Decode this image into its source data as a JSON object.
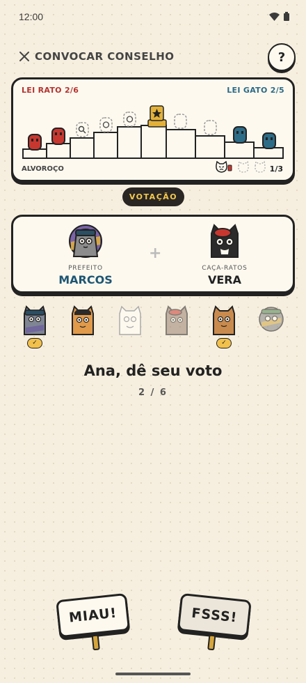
{
  "status_bar": {
    "time": "12:00",
    "icons": [
      "wifi-icon",
      "battery-icon"
    ]
  },
  "header": {
    "close_icon": "close-icon",
    "title": "CONVOCAR CONSELHO",
    "help_label": "?"
  },
  "law_track": {
    "rat_law": "LEI RATO 2/6",
    "cat_law": "LEI GATO 2/5",
    "rat_law_passed": 2,
    "rat_law_total": 6,
    "cat_law_passed": 2,
    "cat_law_total": 5,
    "chaos_label": "ALVOROÇO",
    "chaos_count": "1/3",
    "colors": {
      "rat": "#b3322e",
      "cat": "#2c6a86",
      "gold": "#e3b13a"
    }
  },
  "phase": {
    "label": "VOTAÇÃO"
  },
  "nominees": [
    {
      "role": "PREFEITO",
      "name": "MARCOS",
      "name_color": "#1e5673"
    },
    {
      "role": "CAÇA-RATOS",
      "name": "VERA",
      "name_color": "#222222"
    }
  ],
  "nominee_separator": "+",
  "players": [
    {
      "voted": true,
      "check": "✓",
      "state": "active"
    },
    {
      "voted": false,
      "state": "active"
    },
    {
      "voted": false,
      "state": "ghost"
    },
    {
      "voted": false,
      "state": "faded"
    },
    {
      "voted": true,
      "check": "✓",
      "state": "active"
    },
    {
      "voted": false,
      "state": "faded"
    }
  ],
  "prompt": {
    "text": "Ana, dê seu voto",
    "progress": "2 / 6"
  },
  "vote_buttons": {
    "yes": "MIAU!",
    "no": "FSSS!"
  }
}
